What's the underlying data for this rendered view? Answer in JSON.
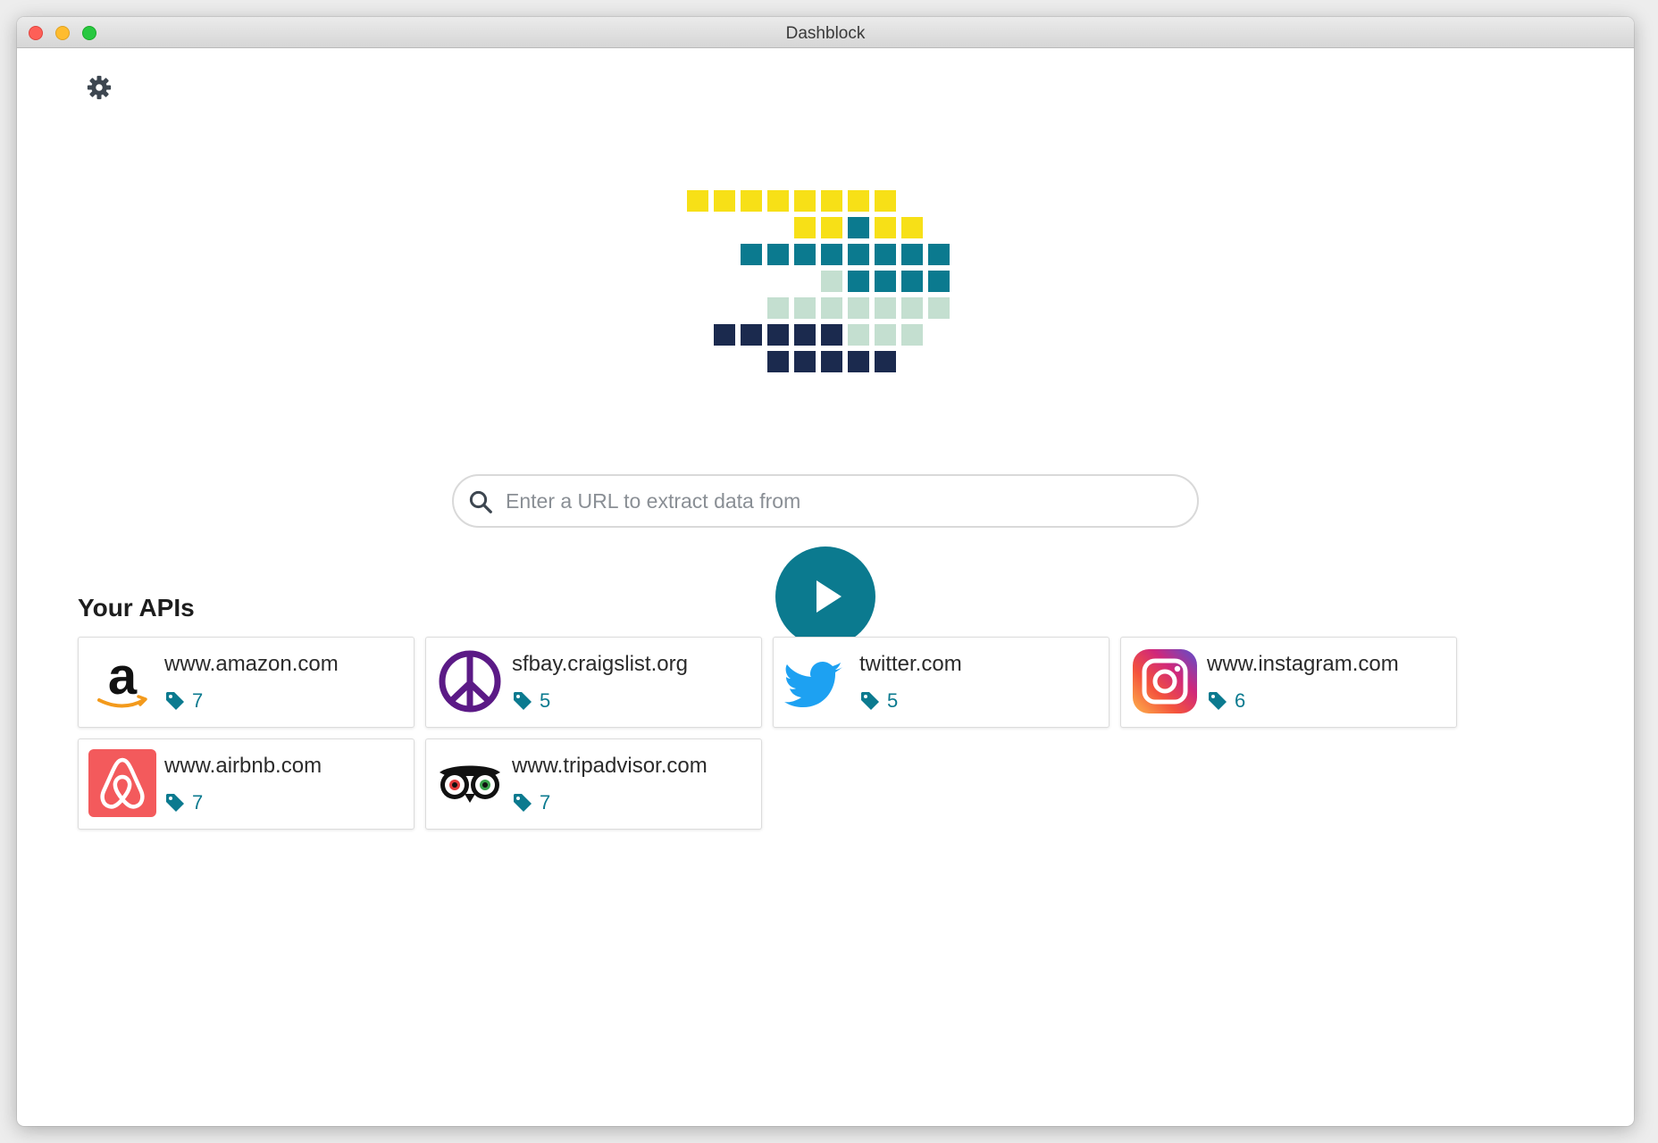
{
  "window": {
    "title": "Dashblock"
  },
  "search": {
    "placeholder": "Enter a URL to extract data from",
    "value": ""
  },
  "section": {
    "title": "Your APIs"
  },
  "apis": [
    {
      "name": "www.amazon.com",
      "count": "7",
      "icon": "amazon-logo-icon"
    },
    {
      "name": "sfbay.craigslist.org",
      "count": "5",
      "icon": "peace-sign-icon"
    },
    {
      "name": "twitter.com",
      "count": "5",
      "icon": "twitter-bird-icon"
    },
    {
      "name": "www.instagram.com",
      "count": "6",
      "icon": "instagram-logo-icon"
    },
    {
      "name": "www.airbnb.com",
      "count": "7",
      "icon": "airbnb-logo-icon"
    },
    {
      "name": "www.tripadvisor.com",
      "count": "7",
      "icon": "tripadvisor-owl-icon"
    }
  ],
  "colors": {
    "accent": "#0b7a8f",
    "yellow": "#f7e017",
    "teal": "#0b7a8f",
    "mint": "#c4dfd0",
    "navy": "#1b2a4e"
  },
  "icons": {
    "settings": "gear-icon",
    "search": "search-icon",
    "play": "play-icon",
    "tag": "tag-icon"
  }
}
